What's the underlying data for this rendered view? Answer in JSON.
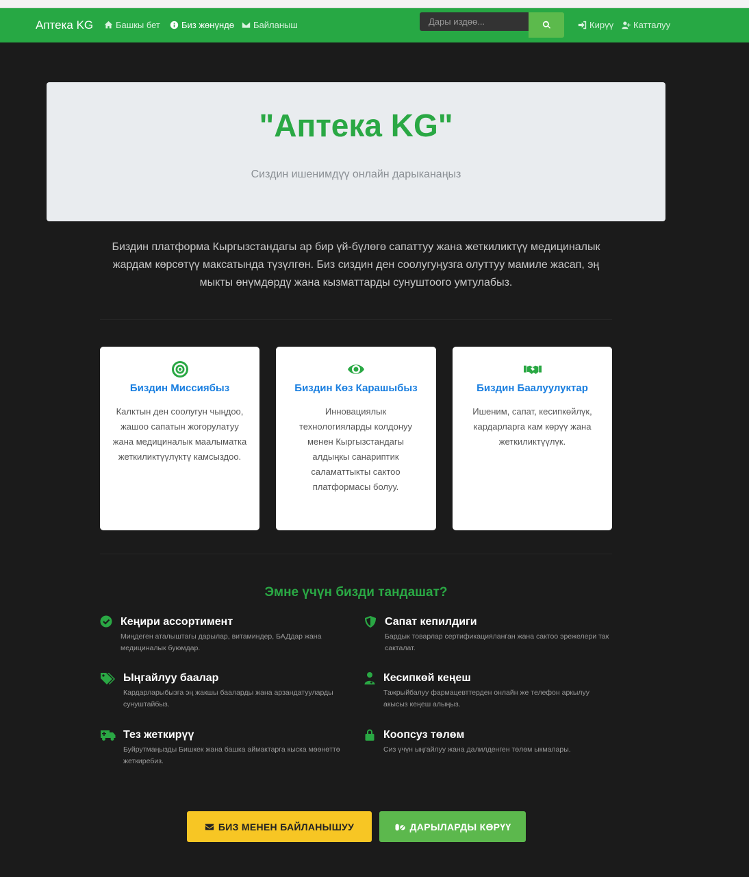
{
  "nav": {
    "brand": "Аптека KG",
    "links": [
      {
        "label": "Башкы бет",
        "icon": "home-icon"
      },
      {
        "label": "Биз жөнүндө",
        "icon": "info-icon"
      },
      {
        "label": "Байланыш",
        "icon": "envelope-icon"
      }
    ],
    "search_placeholder": "Дары издөө...",
    "search_icon": "search-icon",
    "login": {
      "label": "Кирүү",
      "icon": "sign-in-icon"
    },
    "register": {
      "label": "Катталуу",
      "icon": "user-plus-icon"
    }
  },
  "hero": {
    "title": "\"Аптека KG\"",
    "subtitle": "Сиздин ишенимдүү онлайн дарыканаңыз"
  },
  "intro": "Биздин платформа Кыргызстандагы ар бир үй-бүлөгө сапаттуу жана жеткиликтүү медициналык жардам көрсөтүү максатында түзүлгөн. Биз сиздин ден соолугуңузга олуттуу мамиле жасап, эң мыкты өнүмдөрдү жана кызматтарды сунуштоого умтулабыз.",
  "cards": [
    {
      "icon": "bullseye-icon",
      "title": "Биздин Миссиябыз",
      "text": "Калктын ден соолугун чыңдоо, жашоо сапатын жогорулатуу жана медициналык маалыматка жеткиликтүүлүктү камсыздоо."
    },
    {
      "icon": "eye-icon",
      "title": "Биздин Көз Карашыбыз",
      "text": "Инновациялык технологияларды колдонуу менен Кыргызстандагы алдыңкы санариптик саламаттыкты сактоо платформасы болуу."
    },
    {
      "icon": "handshake-icon",
      "title": "Биздин Баалуулуктар",
      "text": "Ишеним, сапат, кесипкөйлүк, кардарларга кам көрүү жана жеткиликтүүлүк."
    }
  ],
  "why": {
    "title": "Эмне үчүн бизди тандашат?",
    "features": [
      {
        "icon": "check-circle-icon",
        "title": "Кеңири ассортимент",
        "text": "Миңдеген аталыштагы дарылар, витаминдер, БАДдар жана медициналык буюмдар."
      },
      {
        "icon": "shield-icon",
        "title": "Сапат кепилдиги",
        "text": "Бардык товарлар сертификацияланган жана сактоо эрежелери так сакталат."
      },
      {
        "icon": "tags-icon",
        "title": "Ыңгайлуу баалар",
        "text": "Кардарларыбызга эң жакшы бааларды жана арзандатууларды сунуштайбыз."
      },
      {
        "icon": "user-md-icon",
        "title": "Кесипкөй кеңеш",
        "text": "Тажрыйбалуу фармацевттерден онлайн же телефон аркылуу акысыз кеңеш алыңыз."
      },
      {
        "icon": "truck-icon",
        "title": "Тез жеткирүү",
        "text": "Буйрутмаңызды Бишкек жана башка аймактарга кыска мөөнөттө жеткиребиз."
      },
      {
        "icon": "lock-icon",
        "title": "Коопсуз төлөм",
        "text": "Сиз үчүн ыңгайлуу жана далилденген төлөм ыкмалары."
      }
    ]
  },
  "buttons": {
    "contact": {
      "label": "БИЗ МЕНЕН БАЙЛАНЫШУУ",
      "icon": "envelope-icon"
    },
    "medicines": {
      "label": "ДАРЫЛАРДЫ КӨРҮҮ",
      "icon": "pills-icon"
    }
  },
  "colors": {
    "accent": "#2aa844",
    "navbar": "#27a844",
    "link": "#1a7fe0",
    "yellow": "#f7c624",
    "background": "#1b1b1b"
  }
}
